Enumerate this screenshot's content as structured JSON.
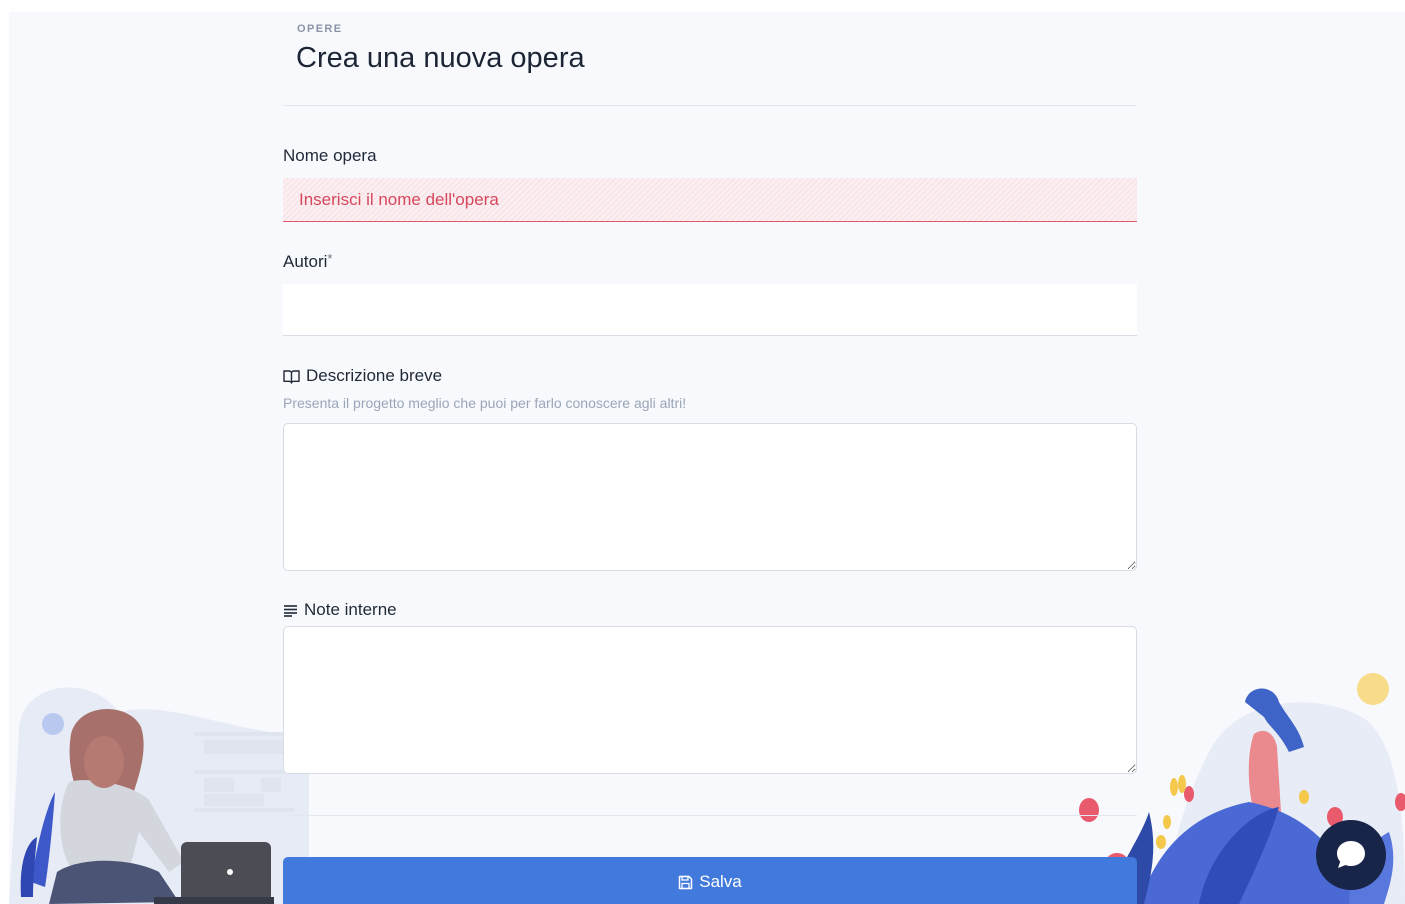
{
  "header": {
    "eyebrow": "OPERE",
    "title": "Crea una nuova opera"
  },
  "form": {
    "name_label": "Nome opera",
    "name_placeholder": "Inserisci il nome dell'opera",
    "authors_label": "Autori",
    "authors_required_mark": "*",
    "description_label": "Descrizione breve",
    "description_hint": "Presenta il progetto meglio che puoi per farlo conoscere agli altri!",
    "notes_label": "Note interne",
    "save_label": "Salva"
  },
  "icons": {
    "description": "book-open-icon",
    "notes": "text-lines-icon",
    "save": "floppy-disk-icon",
    "chat": "chat-bubble-icon"
  },
  "colors": {
    "primary": "#4179dc",
    "error": "#d6485d",
    "chat": "#182448"
  }
}
